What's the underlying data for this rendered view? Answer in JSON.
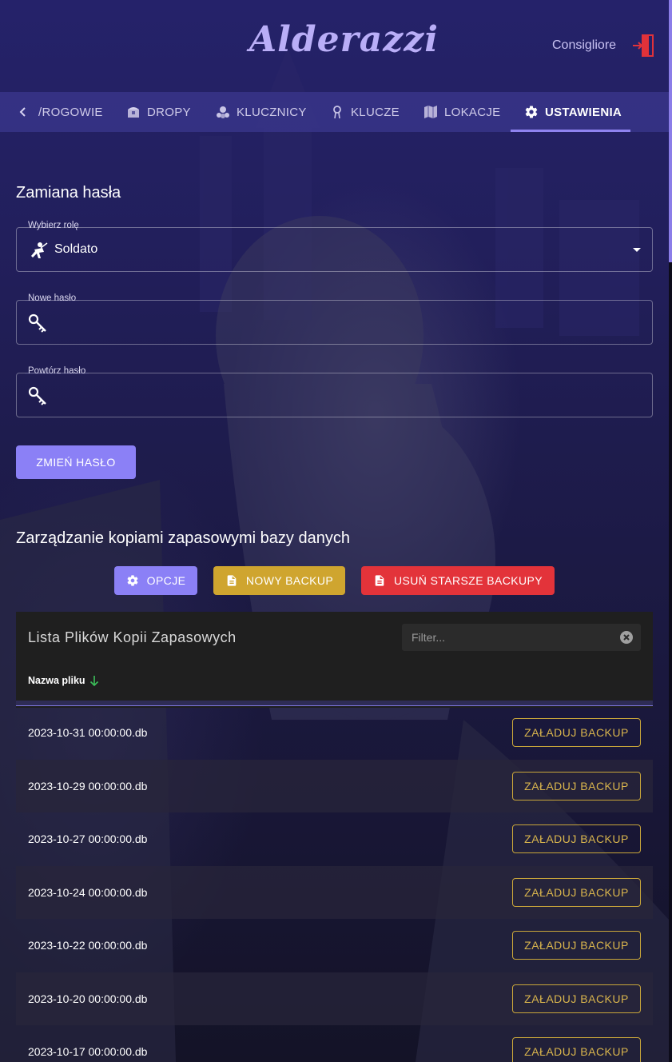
{
  "app": {
    "title": "Alderazzi",
    "user": "Consigliore"
  },
  "nav": {
    "tabs": [
      {
        "label": "/ROGOWIE",
        "icon": "partial-tab"
      },
      {
        "label": "DROPY",
        "icon": "treasure-chest-icon"
      },
      {
        "label": "KLUCZNICY",
        "icon": "key-holder-icon"
      },
      {
        "label": "KLUCZE",
        "icon": "keyring-icon"
      },
      {
        "label": "LOKACJE",
        "icon": "map-icon"
      },
      {
        "label": "USTAWIENIA",
        "icon": "gear-icon",
        "active": true
      }
    ]
  },
  "password": {
    "title": "Zamiana hasła",
    "role_label": "Wybierz rolę",
    "role_value": "Soldato",
    "new_label": "Nowe hasło",
    "repeat_label": "Powtórz hasło",
    "submit": "ZMIEŃ HASŁO"
  },
  "backup": {
    "title": "Zarządzanie kopiami zapasowymi bazy danych",
    "options_btn": "OPCJE",
    "new_btn": "NOWY BACKUP",
    "delete_btn": "USUŃ STARSZE BACKUPY",
    "list_title": "Lista Plików Kopii Zapasowych",
    "filter_placeholder": "Filter...",
    "column_name": "Nazwa pliku",
    "load_label": "ZAŁADUJ BACKUP",
    "files": [
      "2023-10-31 00:00:00.db",
      "2023-10-29 00:00:00.db",
      "2023-10-27 00:00:00.db",
      "2023-10-24 00:00:00.db",
      "2023-10-22 00:00:00.db",
      "2023-10-20 00:00:00.db",
      "2023-10-17 00:00:00.db"
    ]
  },
  "colors": {
    "accent": "#8b80f6",
    "warn": "#cfa52f",
    "danger": "#e3333a",
    "logo": "#b9aef7"
  }
}
